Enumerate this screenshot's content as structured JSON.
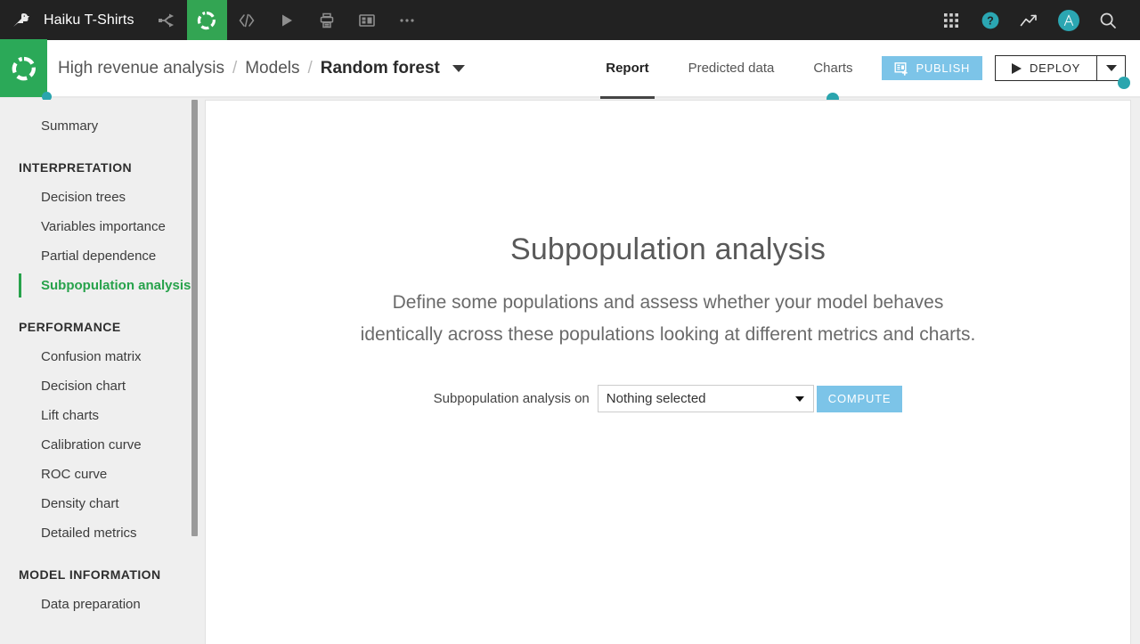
{
  "topbar": {
    "logo_icon": "bird-logo-icon",
    "project_name": "Haiku T-Shirts",
    "left_icons": [
      {
        "name": "flow-icon",
        "label": "Flow"
      },
      {
        "name": "lab-icon",
        "label": "Lab",
        "active": true
      },
      {
        "name": "code-icon",
        "label": "Code"
      },
      {
        "name": "jobs-icon",
        "label": "Jobs"
      },
      {
        "name": "automation-icon",
        "label": "Automation"
      },
      {
        "name": "dashboard-icon",
        "label": "Dashboards"
      },
      {
        "name": "more-icon",
        "label": "More"
      }
    ],
    "right_icons": [
      {
        "name": "apps-grid-icon",
        "label": "Apps"
      },
      {
        "name": "help-icon",
        "label": "Help"
      },
      {
        "name": "activity-icon",
        "label": "Activity"
      },
      {
        "name": "avatar",
        "label": "A"
      },
      {
        "name": "search-icon",
        "label": "Search"
      }
    ]
  },
  "subbar": {
    "logo_icon": "dss-circle-icon",
    "breadcrumb": {
      "root": "High revenue analysis",
      "separator": "/",
      "middle": "Models",
      "current": "Random forest"
    },
    "tabs": [
      {
        "label": "Report",
        "active": true,
        "dot": false
      },
      {
        "label": "Predicted data",
        "active": false,
        "dot": false
      },
      {
        "label": "Charts",
        "active": false,
        "dot": true
      }
    ],
    "publish_label": "PUBLISH",
    "deploy_label": "DEPLOY"
  },
  "sidebar": {
    "groups": [
      {
        "section": null,
        "items": [
          {
            "label": "Summary",
            "active": false
          }
        ]
      },
      {
        "section": "INTERPRETATION",
        "items": [
          {
            "label": "Decision trees",
            "active": false
          },
          {
            "label": "Variables importance",
            "active": false
          },
          {
            "label": "Partial dependence",
            "active": false
          },
          {
            "label": "Subpopulation analysis",
            "active": true
          }
        ]
      },
      {
        "section": "PERFORMANCE",
        "items": [
          {
            "label": "Confusion matrix",
            "active": false
          },
          {
            "label": "Decision chart",
            "active": false
          },
          {
            "label": "Lift charts",
            "active": false
          },
          {
            "label": "Calibration curve",
            "active": false
          },
          {
            "label": "ROC curve",
            "active": false
          },
          {
            "label": "Density chart",
            "active": false
          },
          {
            "label": "Detailed metrics",
            "active": false
          }
        ]
      },
      {
        "section": "MODEL INFORMATION",
        "items": [
          {
            "label": "Data preparation",
            "active": false
          }
        ]
      }
    ]
  },
  "main": {
    "title": "Subpopulation analysis",
    "description": "Define some populations and assess whether your model behaves identically across these populations looking at different metrics and charts.",
    "form": {
      "label": "Subpopulation analysis on",
      "select_value": "Nothing selected",
      "select_placeholder": "Nothing selected",
      "compute_label": "COMPUTE"
    }
  },
  "colors": {
    "topbar_bg": "#222222",
    "brand_green": "#2ba958",
    "active_green": "#27a24b",
    "teal_dot": "#2aa5ae",
    "publish_blue": "#7cc4e8",
    "panel_bg": "#efefef"
  }
}
